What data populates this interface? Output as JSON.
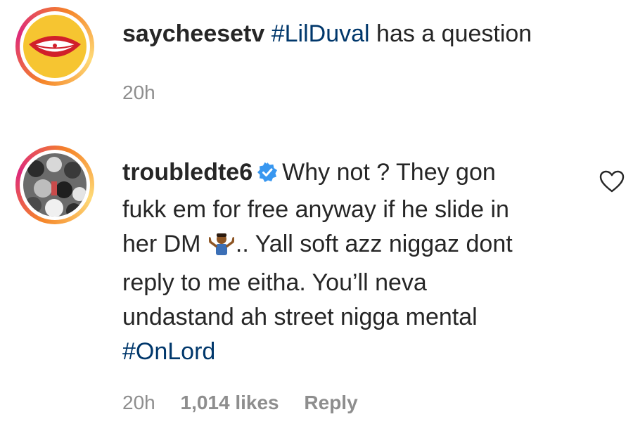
{
  "comments": [
    {
      "username": "saycheesetv",
      "hashtag": "#LilDuval",
      "text": " has a question",
      "time": "20h",
      "avatar_icon": "lips-logo-icon"
    },
    {
      "username": "troubledte6",
      "verified": true,
      "line1": "Why not ? They gon",
      "line2": "fukk em for free anyway if he slide in",
      "line3_a": "her DM ",
      "line3_b": ".. Yall soft azz niggaz dont",
      "line4": "reply to me eitha. You’ll neva",
      "line5": "undastand ah street nigga mental",
      "hashtag": "#OnLord",
      "emoji_icon": "shrug-emoji-icon",
      "time": "20h",
      "likes": "1,014 likes",
      "reply": "Reply",
      "avatar_icon": "crowd-photo-icon"
    }
  ],
  "colors": {
    "text": "#262626",
    "hashtag": "#00376b",
    "meta": "#8e8e8e",
    "verified": "#3897f0"
  }
}
